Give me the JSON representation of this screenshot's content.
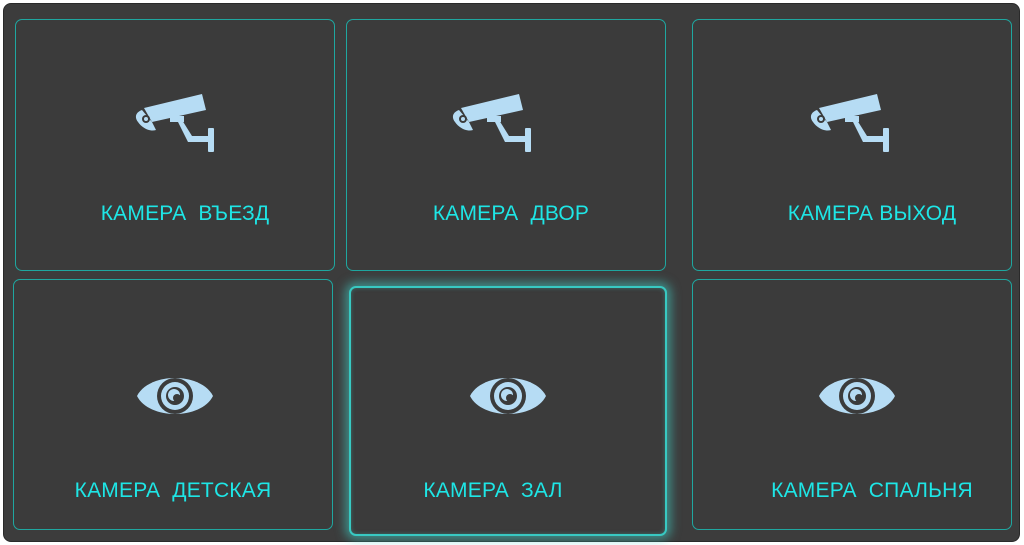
{
  "colors": {
    "background": "#3c3c3c",
    "tile_border": "#1fa7a0",
    "label": "#1ee6e6",
    "icon": "#b6dcf4",
    "active_glow": "#40d2c8"
  },
  "tiles": [
    {
      "label": "КАМЕРА  ВЪЕЗД",
      "icon": "security-camera-icon"
    },
    {
      "label": "КАМЕРА  ДВОР",
      "icon": "security-camera-icon"
    },
    {
      "label": "КАМЕРА ВЫХОД",
      "icon": "security-camera-icon"
    },
    {
      "label": "КАМЕРА  ДЕТСКАЯ",
      "icon": "eye-icon"
    },
    {
      "label": "КАМЕРА  ЗАЛ",
      "icon": "eye-icon",
      "selected": true
    },
    {
      "label": "КАМЕРА  СПАЛЬНЯ",
      "icon": "eye-icon"
    }
  ]
}
